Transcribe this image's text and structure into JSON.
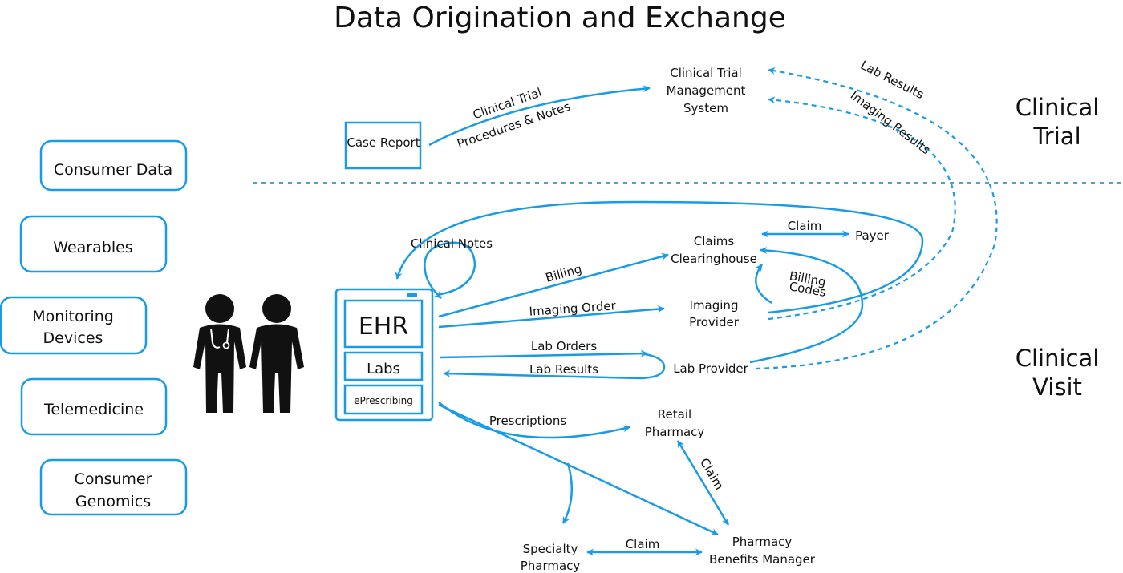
{
  "title": "Data Origination and Exchange",
  "sections": {
    "clinical_trial": [
      "Clinical",
      "Trial"
    ],
    "clinical_visit": [
      "Clinical",
      "Visit"
    ]
  },
  "sources": [
    [
      "Consumer Data"
    ],
    [
      "Wearables"
    ],
    [
      "Monitoring",
      "Devices"
    ],
    [
      "Telemedicine"
    ],
    [
      "Consumer",
      "Genomics"
    ]
  ],
  "ehr": {
    "main": "EHR",
    "labs": "Labs",
    "eprescribing": "ePrescribing"
  },
  "nodes": {
    "case_report": "Case Report",
    "ctms": [
      "Clinical Trial",
      "Management",
      "System"
    ],
    "claims_clearinghouse": [
      "Claims",
      "Clearinghouse"
    ],
    "payer": "Payer",
    "imaging_provider": [
      "Imaging",
      "Provider"
    ],
    "lab_provider": "Lab Provider",
    "retail_pharmacy": [
      "Retail",
      "Pharmacy"
    ],
    "pbm": [
      "Pharmacy",
      "Benefits Manager"
    ],
    "specialty_pharmacy": [
      "Specialty",
      "Pharmacy"
    ]
  },
  "edges": {
    "clinical_trial_notes": [
      "Clinical Trial",
      "Procedures & Notes"
    ],
    "lab_results_trial": "Lab Results",
    "imaging_results_trial": "Imaging Results",
    "clinical_notes": "Clinical Notes",
    "billing": "Billing",
    "imaging_order": "Imaging Order",
    "lab_orders": "Lab Orders",
    "lab_results": "Lab Results",
    "claim_payer": "Claim",
    "billing_codes": [
      "Billing",
      "Codes"
    ],
    "prescriptions": "Prescriptions",
    "claim_retail_pbm": "Claim",
    "claim_specialty_pbm": "Claim"
  },
  "colors": {
    "accent": "#1a9be6",
    "text": "#111111"
  },
  "icons": [
    "doctor-icon",
    "patient-icon"
  ]
}
